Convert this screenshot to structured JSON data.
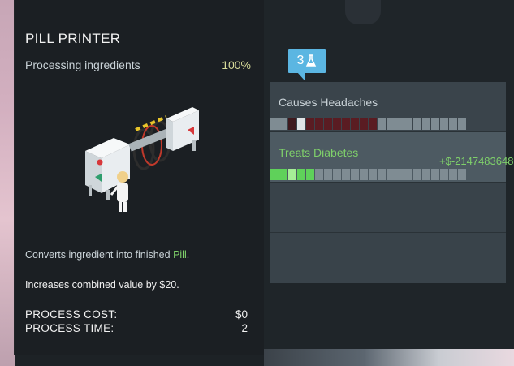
{
  "machine": {
    "title": "PILL PRINTER",
    "status": "Processing ingredients",
    "progress_text": "100%",
    "progress": 1.0,
    "description_prefix": "Converts ingredient into finished ",
    "description_highlight": "Pill",
    "description_suffix": ".",
    "value_text": "Increases combined value by $20.",
    "process_cost_label": "PROCESS COST:",
    "process_cost_value": "$0",
    "process_time_label": "PROCESS TIME:",
    "process_time_value": "2"
  },
  "effects_badge": {
    "count": "3",
    "icon": "flask-icon"
  },
  "effects": [
    {
      "name": "Causes Headaches",
      "value": "",
      "cells": [
        "e",
        "e",
        "m",
        "w",
        "r",
        "r",
        "r",
        "r",
        "r",
        "r",
        "r",
        "r",
        "e",
        "e",
        "e",
        "e",
        "e",
        "e",
        "e",
        "e",
        "e",
        "e"
      ]
    },
    {
      "name": "Treats Diabetes",
      "value": "+$-2147483648",
      "cells": [
        "g",
        "g",
        "l",
        "g",
        "g",
        "e",
        "e",
        "e",
        "e",
        "e",
        "e",
        "e",
        "e",
        "e",
        "e",
        "e",
        "e",
        "e",
        "e",
        "e",
        "e",
        "e"
      ]
    }
  ],
  "colors": {
    "empty": "#7f8c93",
    "white": "#dfe4e6",
    "dark_red": "#5a1c22",
    "maroon": "#3f1a1e",
    "green": "#5fd15a",
    "light_green": "#a6ee97",
    "accent_blue": "#5bb6e2",
    "positive_green": "#7fd06a"
  }
}
